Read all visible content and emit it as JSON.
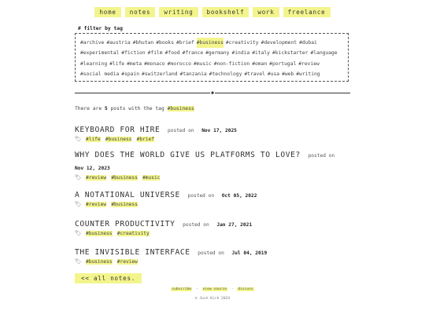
{
  "nav": {
    "items": [
      "home",
      "notes",
      "writing",
      "bookshelf",
      "work",
      "freelance"
    ]
  },
  "filter": {
    "heading": "# filter by tag",
    "active_tag": "#business",
    "tags": [
      "#archive",
      "#austria",
      "#bhutan",
      "#books",
      "#brief",
      "#business",
      "#creativity",
      "#development",
      "#dubai",
      "#experimental",
      "#fiction",
      "#film",
      "#food",
      "#france",
      "#germany",
      "#india",
      "#italy",
      "#kickstarter",
      "#language",
      "#learning",
      "#life",
      "#meta",
      "#monaco",
      "#morocco",
      "#music",
      "#non-fiction",
      "#oman",
      "#portugal",
      "#review",
      "#social media",
      "#spain",
      "#switzerland",
      "#tanzania",
      "#technology",
      "#travel",
      "#usa",
      "#web",
      "#writing"
    ]
  },
  "divider": {
    "mark": "◆"
  },
  "summary": {
    "prefix": "There are",
    "count": "5",
    "middle": "posts with the tag",
    "tag": "#business"
  },
  "posts": [
    {
      "title": "KEYBOARD FOR HIRE",
      "posted_on": "posted on",
      "date": "Nov 17, 2025",
      "tags": [
        "#life",
        "#business",
        "#brief"
      ]
    },
    {
      "title": "WHY DOES THE WORLD GIVE US PLATFORMS TO LOVE?",
      "posted_on": "posted on",
      "date": "Nov 12, 2023",
      "tags": [
        "#review",
        "#business",
        "#music"
      ]
    },
    {
      "title": "A NOTATIONAL UNIVERSE",
      "posted_on": "posted on",
      "date": "Oct 05, 2022",
      "tags": [
        "#review",
        "#business"
      ]
    },
    {
      "title": "COUNTER PRODUCTIVITY",
      "posted_on": "posted on",
      "date": "Jan 27, 2021",
      "tags": [
        "#business",
        "#creativity"
      ]
    },
    {
      "title": "THE INVISIBLE INTERFACE",
      "posted_on": "posted on",
      "date": "Jul 04, 2019",
      "tags": [
        "#business",
        "#review"
      ]
    }
  ],
  "back_label": "<< all notes.",
  "footer": {
    "links": [
      "subscribe",
      "view source",
      "discuss"
    ],
    "separator": "·",
    "copyright": "© Josh Kirk 2024"
  },
  "colors": {
    "highlight": "#f3f58c",
    "text": "#333333"
  },
  "icons": {
    "tag": "tag-icon",
    "divider": "diamond-icon"
  }
}
